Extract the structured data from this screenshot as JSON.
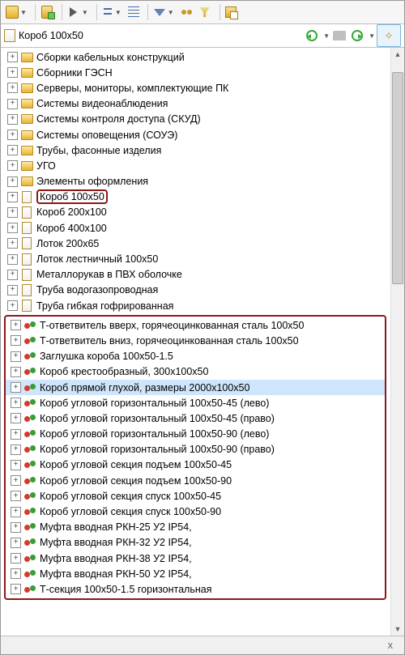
{
  "path": {
    "title": "Короб 100x50"
  },
  "folders": [
    {
      "label": "Сборки кабельных конструкций"
    },
    {
      "label": "Сборники ГЭСН"
    },
    {
      "label": "Серверы, мониторы, комплектующие ПК"
    },
    {
      "label": "Системы видеонаблюдения"
    },
    {
      "label": "Системы контроля доступа (СКУД)"
    },
    {
      "label": "Системы оповещения (СОУЭ)"
    },
    {
      "label": "Трубы, фасонные изделия"
    },
    {
      "label": "УГО"
    },
    {
      "label": "Элементы оформления"
    }
  ],
  "docs": [
    {
      "label": "Короб 100x50",
      "highlight": true
    },
    {
      "label": "Короб 200x100"
    },
    {
      "label": "Короб 400x100"
    },
    {
      "label": "Лоток 200x65"
    },
    {
      "label": "Лоток лестничный 100x50"
    },
    {
      "label": "Металлорукав в ПВХ оболочке"
    },
    {
      "label": "Труба водогазопроводная"
    },
    {
      "label": "Труба гибкая гофрированная"
    }
  ],
  "parts": [
    {
      "label": "Т-ответвитель вверх, горячеоцинкованная сталь 100x50"
    },
    {
      "label": "Т-ответвитель вниз, горячеоцинкованная сталь 100x50"
    },
    {
      "label": "Заглушка короба 100x50-1.5"
    },
    {
      "label": "Короб крестообразный, 300x100x50"
    },
    {
      "label": "Короб прямой глухой, размеры 2000x100x50",
      "selected": true
    },
    {
      "label": "Короб угловой горизонтальный 100x50-45 (лево)"
    },
    {
      "label": "Короб угловой горизонтальный 100x50-45 (право)"
    },
    {
      "label": "Короб угловой горизонтальный 100x50-90 (лево)"
    },
    {
      "label": "Короб угловой горизонтальный 100x50-90 (право)"
    },
    {
      "label": "Короб угловой секция подъем 100x50-45"
    },
    {
      "label": "Короб угловой секция подъем 100x50-90"
    },
    {
      "label": "Короб угловой секция спуск 100x50-45"
    },
    {
      "label": "Короб угловой секция спуск 100x50-90"
    },
    {
      "label": "Муфта вводная РКН-25 У2 IP54,"
    },
    {
      "label": "Муфта вводная РКН-32 У2 IP54,"
    },
    {
      "label": "Муфта вводная РКН-38 У2 IP54,"
    },
    {
      "label": "Муфта вводная РКН-50 У2 IP54,"
    },
    {
      "label": "Т-секция 100x50-1.5 горизонтальная"
    }
  ],
  "footer": {
    "close_label": "x"
  }
}
